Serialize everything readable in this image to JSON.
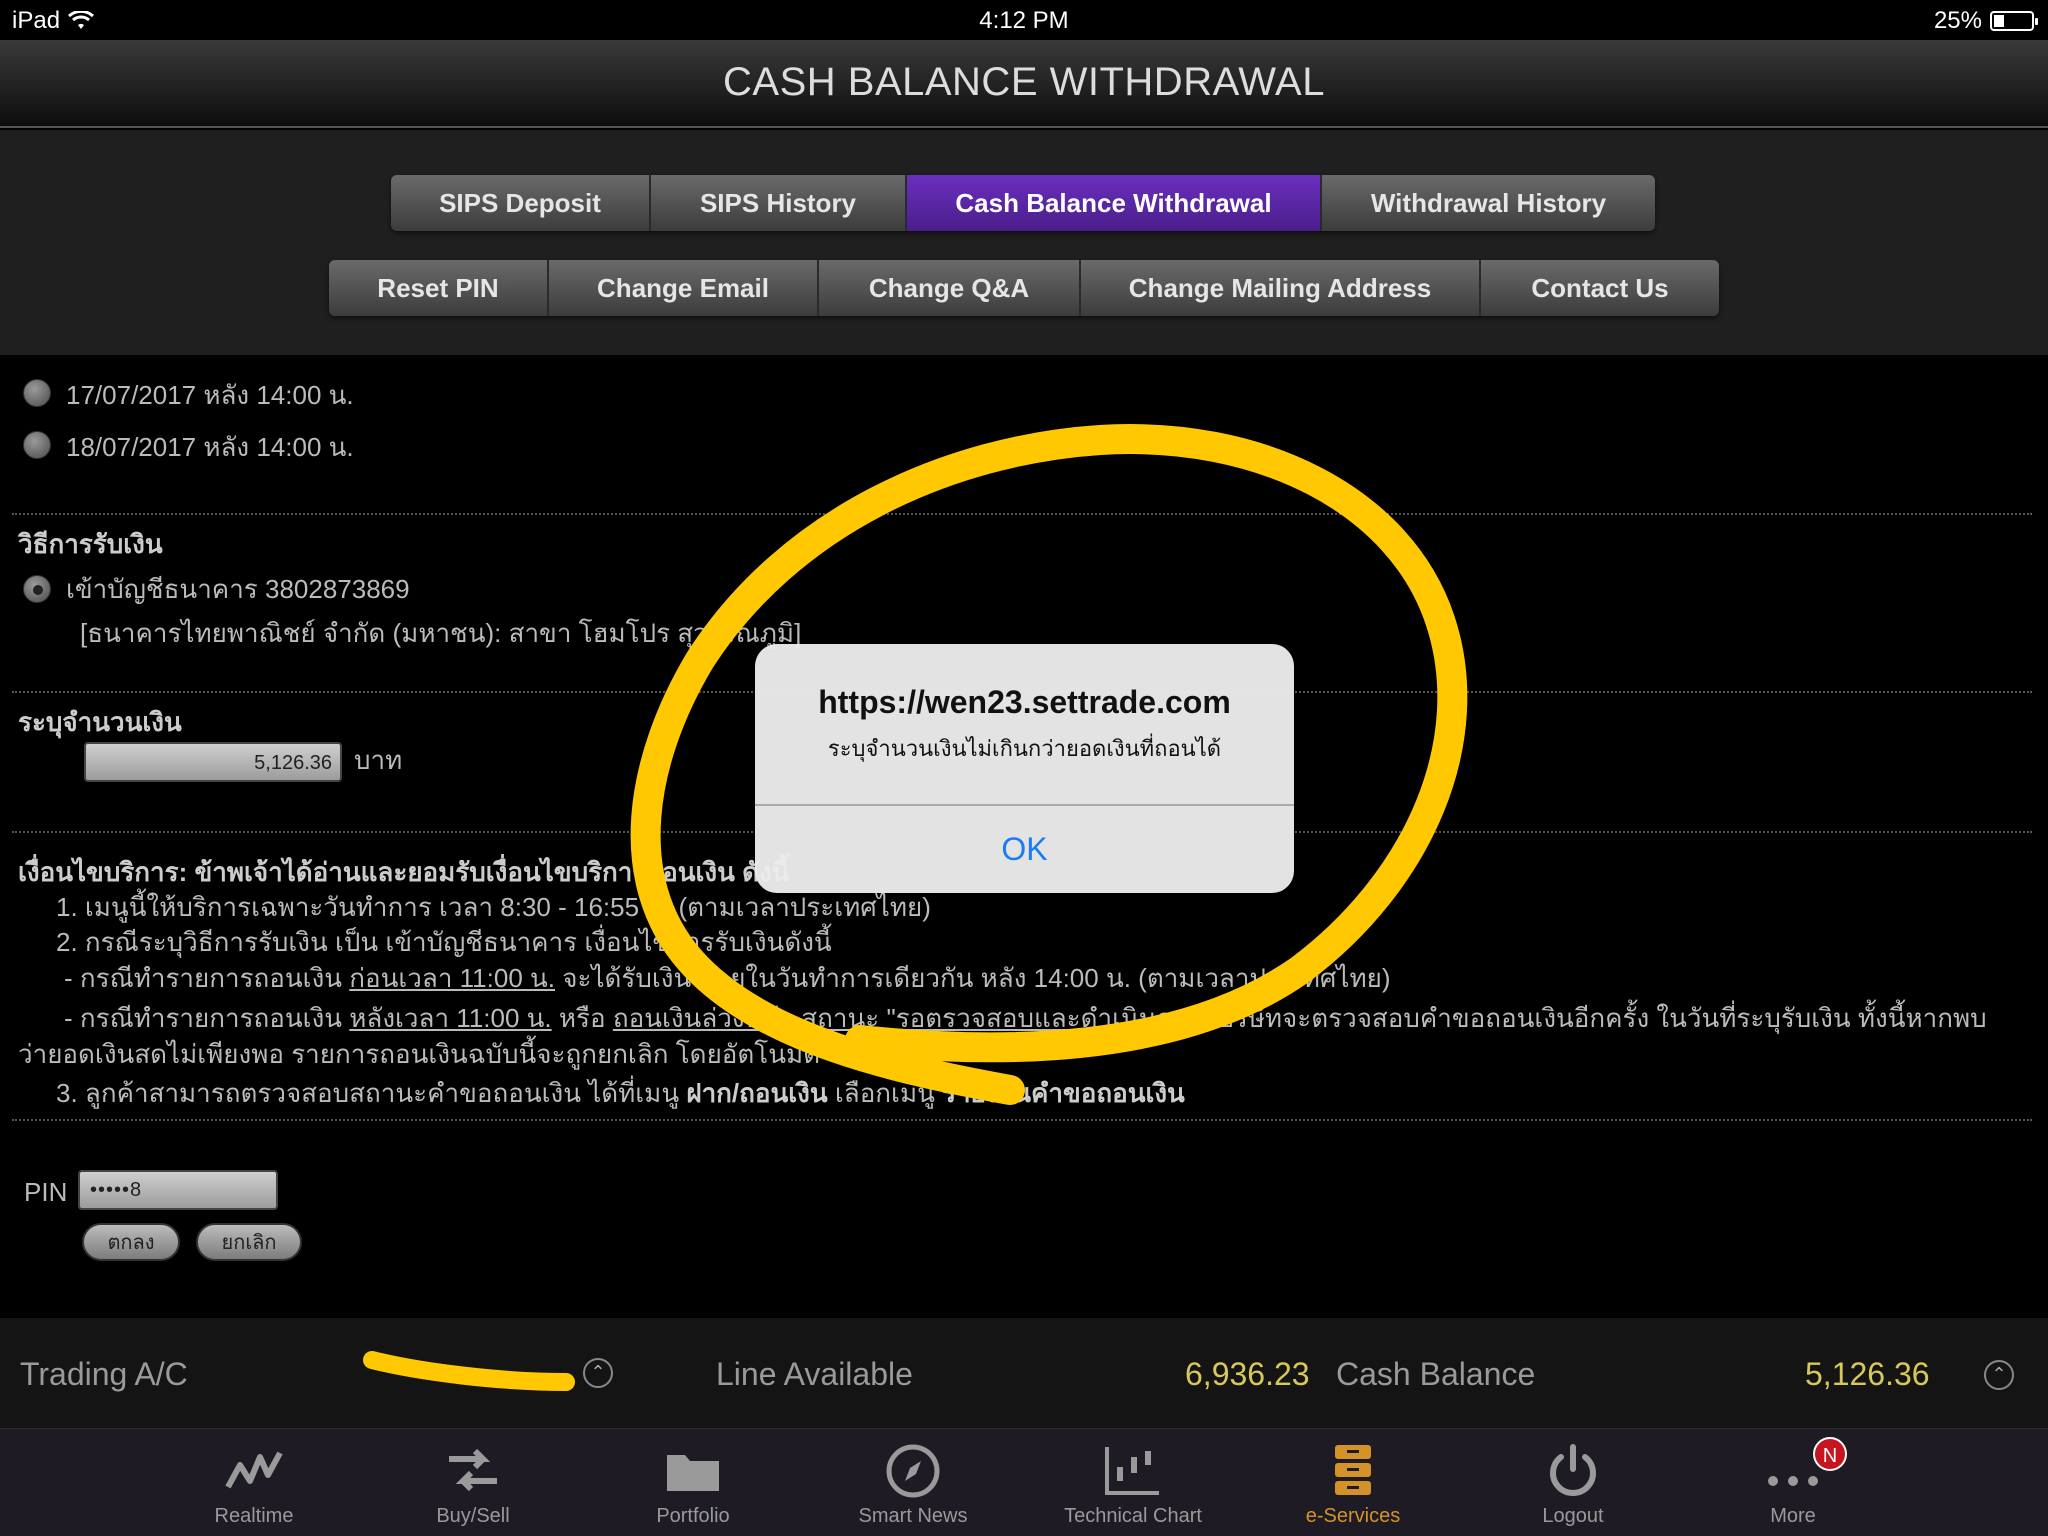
{
  "status_bar": {
    "device": "iPad",
    "time": "4:12 PM",
    "battery": "25%"
  },
  "header": {
    "title": "CASH BALANCE WITHDRAWAL"
  },
  "tabs_row1": [
    {
      "label": "SIPS Deposit",
      "active": false
    },
    {
      "label": "SIPS History",
      "active": false
    },
    {
      "label": "Cash Balance Withdrawal",
      "active": true
    },
    {
      "label": "Withdrawal History",
      "active": false
    }
  ],
  "tabs_row2": [
    {
      "label": "Reset PIN"
    },
    {
      "label": "Change Email"
    },
    {
      "label": "Change Q&A"
    },
    {
      "label": "Change Mailing Address"
    },
    {
      "label": "Contact Us"
    }
  ],
  "date_options": [
    {
      "label": "17/07/2017 หลัง 14:00 น.",
      "selected": false
    },
    {
      "label": "18/07/2017 หลัง 14:00 น.",
      "selected": false
    }
  ],
  "receive_method": {
    "heading": "วิธีการรับเงิน",
    "option_label": "เข้าบัญชีธนาคาร 3802873869",
    "bank_detail": "[ธนาคารไทยพาณิชย์ จำกัด (มหาชน): สาขา โฮมโปร สุวรรณภูมิ]"
  },
  "amount": {
    "heading": "ระบุจำนวนเงิน",
    "value": "5,126.36",
    "unit": "บาท"
  },
  "terms": {
    "heading": "เงื่อนไขบริการ: ข้าพเจ้าได้อ่านและยอมรับเงื่อนไขบริการถอนเงิน ดังนี้",
    "line1": "1. เมนูนี้ให้บริการเฉพาะวันทำการ เวลา 8:30 - 16:55 น. (ตามเวลาประเทศไทย)",
    "line2": "2. กรณีระบุวิธีการรับเงิน เป็น เข้าบัญชีธนาคาร เงื่อนไขการรับเงินดังนี้",
    "line3_prefix": "- กรณีทำรายการถอนเงิน",
    "line3_link": "ก่อนเวลา 11:00 น.",
    "line3_suffix": "จะได้รับเงิน ภายในวันทำการเดียวกัน หลัง 14:00 น. (ตามเวลาประเทศไทย)",
    "line4_prefix": "- กรณีทำรายการถอนเงิน",
    "line4_link": "หลังเวลา 11:00 น.",
    "line4_mid": "หรือ",
    "line4_link2": "ถอนเงินล่วงหน้า สถานะ \"รอตรวจสอบและดำเนินการ\"",
    "line4_suffix": "บริษัทจะตรวจสอบคำขอถอนเงินอีกครั้ง ในวันที่ระบุรับเงิน ทั้งนี้หากพบ",
    "line5": "ว่ายอดเงินสดไม่เพียงพอ รายการถอนเงินฉบับนี้จะถูกยกเลิก โดยอัตโนมัติ",
    "line6_prefix": "3. ลูกค้าสามารถตรวจสอบสถานะคำขอถอนเงิน ได้ที่เมนู",
    "line6_bold1": "ฝาก/ถอนเงิน",
    "line6_mid": "เลือกเมนู",
    "line6_bold2": "รายงานคำขอถอนเงิน"
  },
  "pin": {
    "label": "PIN",
    "value": "•••••8",
    "ok_label": "ตกลง",
    "cancel_label": "ยกเลิก"
  },
  "info_bar": {
    "trading_label": "Trading A/C",
    "line_available_label": "Line Available",
    "line_available_value": "6,936.23",
    "cash_balance_label": "Cash Balance",
    "cash_balance_value": "5,126.36"
  },
  "tab_bar": [
    {
      "label": "Realtime",
      "icon": "realtime-icon"
    },
    {
      "label": "Buy/Sell",
      "icon": "buy-sell-icon"
    },
    {
      "label": "Portfolio",
      "icon": "folder-icon"
    },
    {
      "label": "Smart News",
      "icon": "compass-icon"
    },
    {
      "label": "Technical Chart",
      "icon": "chart-icon"
    },
    {
      "label": "e-Services",
      "icon": "e-services-icon",
      "active": true
    },
    {
      "label": "Logout",
      "icon": "power-icon"
    },
    {
      "label": "More",
      "icon": "more-icon",
      "badge": "N"
    }
  ],
  "alert": {
    "title": "https://wen23.settrade.com",
    "message": "ระบุจำนวนเงินไม่เกินกว่ายอดเงินที่ถอนได้",
    "ok_label": "OK"
  },
  "colors": {
    "accent_purple": "#5a25a8",
    "value_yellow": "#d8c85a",
    "annotation_yellow": "#ffc800",
    "ios_blue": "#1a7cf5",
    "active_orange": "#d4932a"
  }
}
